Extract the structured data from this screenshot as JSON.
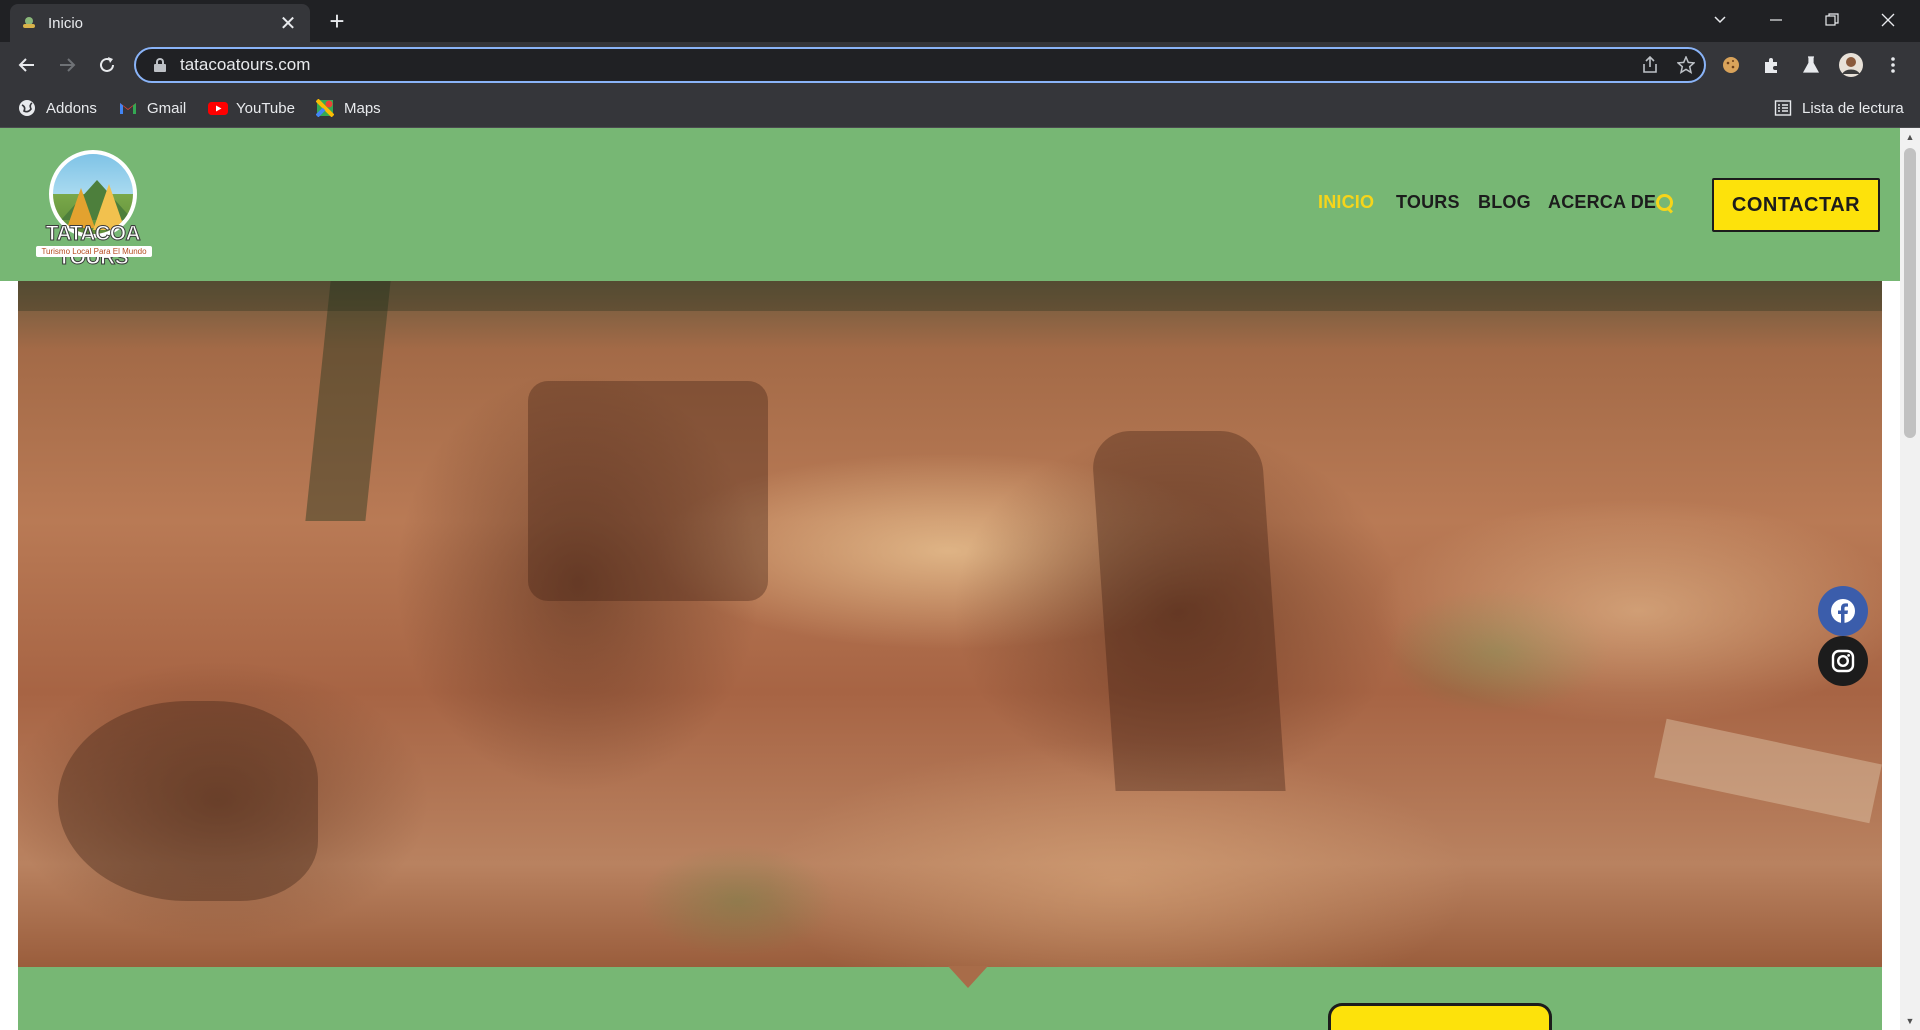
{
  "browser": {
    "tab_title": "Inicio",
    "tab_close": "✕",
    "new_tab": "+",
    "url": "tatacoatours.com",
    "bookmarks": [
      {
        "label": "Addons",
        "icon": "globe-icon"
      },
      {
        "label": "Gmail",
        "icon": "gmail-icon"
      },
      {
        "label": "YouTube",
        "icon": "youtube-icon"
      },
      {
        "label": "Maps",
        "icon": "maps-icon"
      }
    ],
    "reading_list": "Lista de lectura"
  },
  "site": {
    "logo_text": "TATACOA TOURS",
    "logo_tagline": "Turismo Local Para El Mundo",
    "nav": [
      {
        "label": "INICIO",
        "active": true
      },
      {
        "label": "TOURS",
        "active": false
      },
      {
        "label": "BLOG",
        "active": false
      },
      {
        "label": "ACERCA DE",
        "active": false
      }
    ],
    "contact_button": "CONTACTAR",
    "colors": {
      "header_green": "#77b774",
      "accent_yellow": "#fde20b",
      "active_nav": "#f6d51a",
      "facebook_blue": "#3b5dab"
    }
  }
}
